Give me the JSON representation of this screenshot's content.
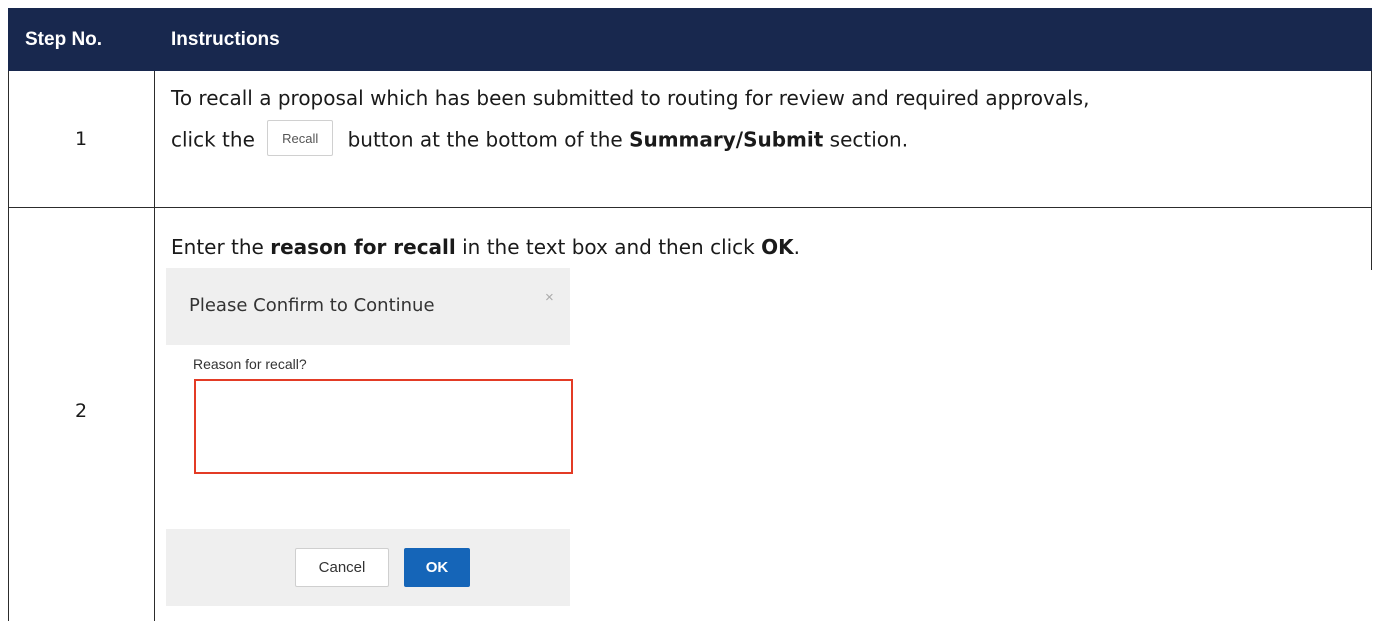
{
  "table": {
    "header": {
      "step_col": "Step No.",
      "instructions_col": "Instructions"
    },
    "rows": [
      {
        "step": "1",
        "line1": "To recall a proposal which has been submitted to routing for review and required approvals,",
        "line2_pre": "click the",
        "button_label": "Recall",
        "line2_mid": "button at the bottom of the",
        "line2_bold": "Summary/Submit",
        "line2_post": "section."
      },
      {
        "step": "2",
        "pre": "Enter the",
        "bold1": "reason for recall",
        "mid": "in the text box and then click",
        "bold2": "OK",
        "post": "."
      }
    ]
  },
  "dialog": {
    "title": "Please Confirm to Continue",
    "close_glyph": "×",
    "label": "Reason for recall?",
    "textarea_value": "",
    "cancel_label": "Cancel",
    "ok_label": "OK",
    "highlight_color": "#e33b25",
    "ok_color": "#1565b8"
  },
  "colors": {
    "header_bg": "#18284e"
  }
}
